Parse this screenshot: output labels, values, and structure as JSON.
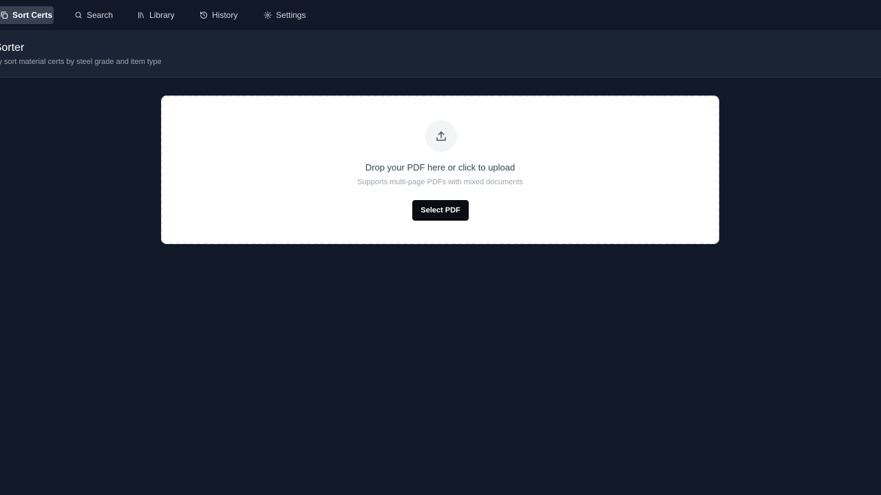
{
  "nav": {
    "items": [
      {
        "label": "Sort Certs",
        "icon": "copy-icon",
        "active": true
      },
      {
        "label": "Search",
        "icon": "search-icon"
      },
      {
        "label": "Library",
        "icon": "library-icon"
      },
      {
        "label": "History",
        "icon": "history-icon"
      },
      {
        "label": "Settings",
        "icon": "gear-icon"
      }
    ]
  },
  "header": {
    "title": "ficate Sorter",
    "subtitle": "omatically sort material certs by steel grade and item type"
  },
  "upload": {
    "icon": "upload-icon",
    "title": "Drop your PDF here or click to upload",
    "subtitle": "Supports multi-page PDFs with mixed documents",
    "button_label": "Select PDF"
  },
  "colors": {
    "background": "#111827",
    "header_background": "#1b2434",
    "active_nav": "#374151",
    "card": "#ffffff",
    "button": "#0b0d12"
  }
}
